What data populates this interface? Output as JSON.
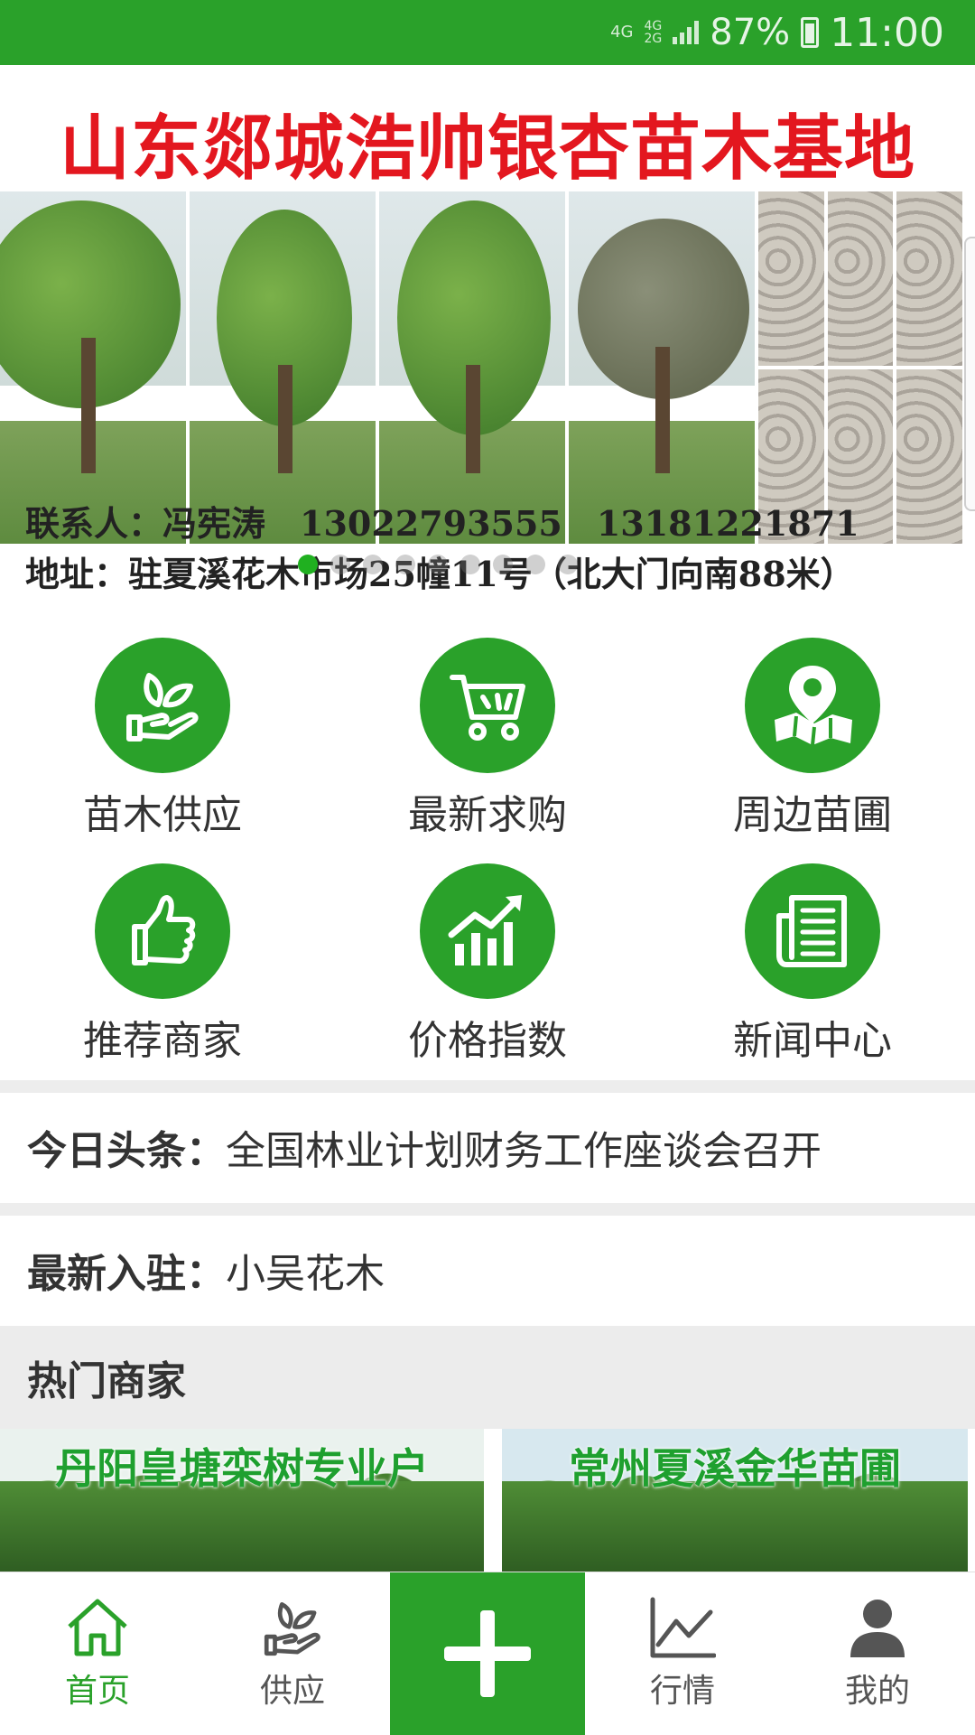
{
  "status_bar": {
    "network1": "4G",
    "network2_top": "4G",
    "network2_bottom": "2G",
    "battery": "87%",
    "time": "11:00"
  },
  "banner": {
    "title": "山东郯城浩帅银杏苗木基地",
    "contact_line1": "联系人：冯宪涛　13022793555　13181221871",
    "contact_line2": "地址：驻夏溪花木市场25幢11号（北大门向南88米）",
    "active_dot": 0
  },
  "menu": [
    {
      "label": "苗木供应",
      "icon": "seedling-hand-icon"
    },
    {
      "label": "最新求购",
      "icon": "cart-icon"
    },
    {
      "label": "周边苗圃",
      "icon": "map-pin-icon"
    },
    {
      "label": "推荐商家",
      "icon": "thumbs-up-icon"
    },
    {
      "label": "价格指数",
      "icon": "trend-chart-icon"
    },
    {
      "label": "新闻中心",
      "icon": "newspaper-icon"
    }
  ],
  "headline": {
    "key": "今日头条：",
    "value": "全国林业计划财务工作座谈会召开"
  },
  "newest": {
    "key": "最新入驻：",
    "value": "小吴花木"
  },
  "hot_merchants": {
    "title": "热门商家",
    "items": [
      {
        "name": "丹阳皇塘栾树专业户"
      },
      {
        "name": "常州夏溪金华苗圃"
      }
    ]
  },
  "bottom_nav": [
    {
      "label": "首页",
      "icon": "home-icon",
      "active": true
    },
    {
      "label": "供应",
      "icon": "supply-icon",
      "active": false
    },
    {
      "label": "",
      "icon": "plus-icon",
      "active": false
    },
    {
      "label": "行情",
      "icon": "chart-icon",
      "active": false
    },
    {
      "label": "我的",
      "icon": "user-icon",
      "active": false
    }
  ],
  "colors": {
    "primary": "#2aa12a",
    "banner_title": "#e3171f",
    "separator": "#ededed"
  }
}
